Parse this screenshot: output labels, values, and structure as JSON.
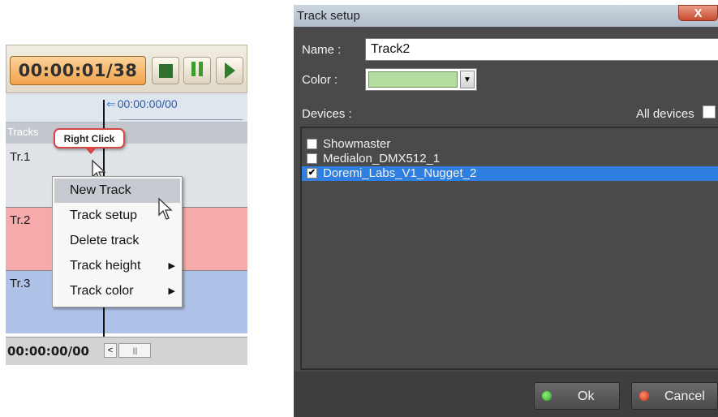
{
  "timeline": {
    "current_time": "00:00:01/38",
    "ruler_time": "00:00:00/00",
    "tracks_header": "Tracks",
    "tracks": [
      {
        "label": "Tr.1",
        "color": "#dfe3e8"
      },
      {
        "label": "Tr.2",
        "color": "#f6aaaa"
      },
      {
        "label": "Tr.3",
        "color": "#aec1e6"
      }
    ],
    "bottom_time": "00:00:00/00",
    "scroll_left_glyph": "<",
    "scroll_thumb_glyph": "||||"
  },
  "annotation": {
    "text": "Right Click"
  },
  "context_menu": {
    "items": [
      {
        "label": "New Track",
        "highlighted": true
      },
      {
        "label": "Track setup"
      },
      {
        "label": "Delete track"
      },
      {
        "label": "Track height",
        "submenu": true
      },
      {
        "label": "Track color",
        "submenu": true
      }
    ],
    "submenu_glyph": "▶"
  },
  "dialog": {
    "title": "Track setup",
    "close_glyph": "X",
    "name_label": "Name :",
    "name_value": "Track2",
    "color_label": "Color :",
    "color_value": "#b6dda0",
    "devices_label": "Devices :",
    "all_devices_label": "All devices",
    "devices": [
      {
        "name": "Showmaster",
        "checked": false
      },
      {
        "name": "Medialon_DMX512_1",
        "checked": false
      },
      {
        "name": "Doremi_Labs_V1_Nugget_2",
        "checked": true,
        "selected": true
      }
    ],
    "check_glyph": "✔",
    "ok_label": "Ok",
    "cancel_label": "Cancel"
  }
}
